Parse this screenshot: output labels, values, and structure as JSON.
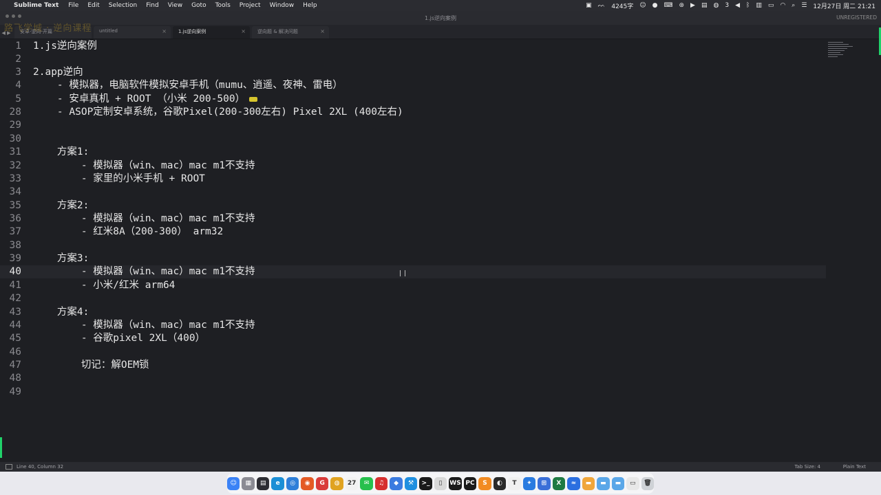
{
  "menubar": {
    "apple_glyph": "",
    "app_name": "Sublime Text",
    "menus": [
      "File",
      "Edit",
      "Selection",
      "Find",
      "View",
      "Goto",
      "Tools",
      "Project",
      "Window",
      "Help"
    ],
    "status": {
      "word_count": "4245字",
      "notification_count": "3",
      "datetime": "12月27日 周二 21:21"
    }
  },
  "window": {
    "title": "1.js逆向案例",
    "unregistered": "UNREGISTERED"
  },
  "overlay_text": "路飞学城 · 逆向课程",
  "tabs": [
    {
      "label": "安卓-逆向-开篇",
      "active": false
    },
    {
      "label": "untitled",
      "active": false
    },
    {
      "label": "1.js逆向案例",
      "active": true
    },
    {
      "label": "逆向题 & 解决问题",
      "active": false
    }
  ],
  "editor": {
    "current_line": "40",
    "lines": [
      {
        "n": "1",
        "text": "1.js逆向案例"
      },
      {
        "n": "2",
        "text": ""
      },
      {
        "n": "3",
        "text": "2.app逆向"
      },
      {
        "n": "4",
        "text": "    - 模拟器，电脑软件模拟安卓手机（mumu、逍遥、夜神、雷电）"
      },
      {
        "n": "5",
        "text": "    - 安卓真机 + ROOT （小米 200-500）"
      },
      {
        "n": "28",
        "text": "    - ASOP定制安卓系统，谷歌Pixel(200-300左右) Pixel 2XL (400左右)"
      },
      {
        "n": "29",
        "text": ""
      },
      {
        "n": "30",
        "text": ""
      },
      {
        "n": "31",
        "text": "    方案1:"
      },
      {
        "n": "32",
        "text": "        - 模拟器（win、mac）mac m1不支持"
      },
      {
        "n": "33",
        "text": "        - 家里的小米手机 + ROOT"
      },
      {
        "n": "34",
        "text": ""
      },
      {
        "n": "35",
        "text": "    方案2:"
      },
      {
        "n": "36",
        "text": "        - 模拟器（win、mac）mac m1不支持"
      },
      {
        "n": "37",
        "text": "        - 红米8A（200-300） arm32"
      },
      {
        "n": "38",
        "text": ""
      },
      {
        "n": "39",
        "text": "    方案3:"
      },
      {
        "n": "40",
        "text": "        - 模拟器（win、mac）mac m1不支持"
      },
      {
        "n": "41",
        "text": "        - 小米/红米 arm64"
      },
      {
        "n": "42",
        "text": ""
      },
      {
        "n": "43",
        "text": "    方案4:"
      },
      {
        "n": "44",
        "text": "        - 模拟器（win、mac）mac m1不支持"
      },
      {
        "n": "45",
        "text": "        - 谷歌pixel 2XL（400）"
      },
      {
        "n": "46",
        "text": ""
      },
      {
        "n": "47",
        "text": "        切记：解OEM锁"
      },
      {
        "n": "48",
        "text": ""
      },
      {
        "n": "49",
        "text": ""
      }
    ]
  },
  "statusbar": {
    "position": "Line 40, Column 32",
    "tab_size": "Tab Size: 4",
    "syntax": "Plain Text"
  },
  "dock": {
    "icons": [
      {
        "name": "finder",
        "color": "#3b82f6",
        "glyph": "☺"
      },
      {
        "name": "launchpad",
        "color": "#8b8b93",
        "glyph": "▦"
      },
      {
        "name": "mission-control",
        "color": "#2d2d33",
        "glyph": "▤"
      },
      {
        "name": "edge",
        "color": "#1c8fd6",
        "glyph": "e"
      },
      {
        "name": "safari",
        "color": "#2f7fd9",
        "glyph": "◎"
      },
      {
        "name": "firefox",
        "color": "#e45a25",
        "glyph": "◉"
      },
      {
        "name": "app-red",
        "color": "#d93b3b",
        "glyph": "G"
      },
      {
        "name": "chrome",
        "color": "#e0a321",
        "glyph": "◍"
      },
      {
        "name": "calendar",
        "color": "#f2f2f2",
        "glyph": "27"
      },
      {
        "name": "wechat",
        "color": "#27c04d",
        "glyph": "✉"
      },
      {
        "name": "netease-music",
        "color": "#d62f2f",
        "glyph": "♫"
      },
      {
        "name": "app-blue",
        "color": "#3b7be0",
        "glyph": "◆"
      },
      {
        "name": "xcode",
        "color": "#1f8fe0",
        "glyph": "⚒"
      },
      {
        "name": "terminal",
        "color": "#1a1a1a",
        "glyph": ">_"
      },
      {
        "name": "preview",
        "color": "#d9d9d9",
        "glyph": "▯"
      },
      {
        "name": "webstorm",
        "color": "#1b1b1b",
        "glyph": "WS"
      },
      {
        "name": "pycharm",
        "color": "#1b1b1b",
        "glyph": "PC"
      },
      {
        "name": "sublime",
        "color": "#f28b22",
        "glyph": "S"
      },
      {
        "name": "app-dark",
        "color": "#2a2a2a",
        "glyph": "◐"
      },
      {
        "name": "typora",
        "color": "#f0f0f0",
        "glyph": "T"
      },
      {
        "name": "app-compass",
        "color": "#2a7be0",
        "glyph": "✦"
      },
      {
        "name": "app-grid",
        "color": "#3a6fd8",
        "glyph": "⊞"
      },
      {
        "name": "excel",
        "color": "#1f7a43",
        "glyph": "X"
      },
      {
        "name": "app-wave",
        "color": "#2b6fe0",
        "glyph": "≈"
      },
      {
        "name": "folder-1",
        "color": "#f0a63a",
        "glyph": "▬"
      },
      {
        "name": "folder-2",
        "color": "#5aa7e8",
        "glyph": "▬"
      },
      {
        "name": "folder-3",
        "color": "#5aa7e8",
        "glyph": "▬"
      },
      {
        "name": "file",
        "color": "#e8e8e8",
        "glyph": "▭"
      },
      {
        "name": "trash",
        "color": "#cfd2d6",
        "glyph": "🗑"
      }
    ]
  }
}
